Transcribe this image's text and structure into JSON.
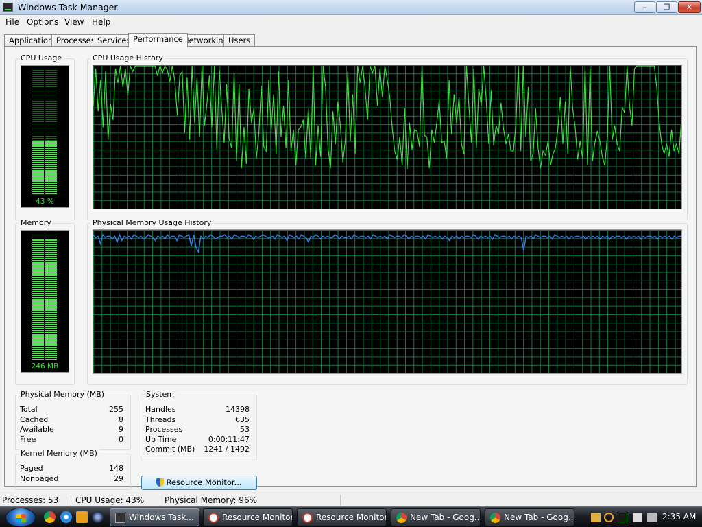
{
  "window": {
    "title": "Windows Task Manager",
    "buttons": {
      "minimize": "‒",
      "maximize": "❐",
      "close": "✕"
    }
  },
  "menu": [
    "File",
    "Options",
    "View",
    "Help"
  ],
  "tabs": [
    "Applications",
    "Processes",
    "Services",
    "Performance",
    "Networking",
    "Users"
  ],
  "active_tab": "Performance",
  "cpu": {
    "group_label": "CPU Usage",
    "value_label": "43 %",
    "percent": 43,
    "history_label": "CPU Usage History",
    "history": [
      72,
      98,
      68,
      90,
      57,
      96,
      48,
      73,
      62,
      98,
      88,
      100,
      85,
      98,
      79,
      100,
      96,
      100,
      100,
      100,
      100,
      100,
      100,
      100,
      100,
      100,
      93,
      100,
      95,
      100,
      97,
      89,
      100,
      90,
      65,
      93,
      96,
      53,
      92,
      48,
      100,
      60,
      92,
      50,
      100,
      58,
      73,
      93,
      57,
      100,
      41,
      97,
      70,
      46,
      87,
      49,
      42,
      95,
      33,
      87,
      28,
      57,
      31,
      84,
      60,
      70,
      35,
      52,
      86,
      43,
      40,
      90,
      55,
      80,
      38,
      96,
      50,
      72,
      42,
      90,
      40,
      55,
      30,
      55,
      57,
      62,
      35,
      70,
      35,
      100,
      30,
      58,
      36,
      100,
      85,
      42,
      28,
      68,
      45,
      75,
      58,
      32,
      48,
      96,
      47,
      80,
      38,
      100,
      88,
      100,
      84,
      62,
      100,
      95,
      100,
      72,
      98,
      78,
      100,
      90,
      78,
      56,
      40,
      34,
      50,
      30,
      70,
      27,
      60,
      41,
      55,
      54,
      43,
      100,
      51,
      50,
      28,
      55,
      46,
      60,
      76,
      46,
      47,
      35,
      90,
      52,
      80,
      60,
      78,
      45,
      38,
      100,
      72,
      46,
      98,
      42,
      84,
      72,
      100,
      77,
      45,
      83,
      44,
      58,
      52,
      74,
      56,
      45,
      52,
      40,
      40,
      58,
      100,
      40,
      100,
      50,
      85,
      33,
      38,
      70,
      42,
      28,
      40,
      37,
      47,
      30,
      38,
      42,
      55,
      78,
      45,
      75,
      38,
      100,
      70,
      57,
      34,
      47,
      35,
      100,
      30,
      98,
      33,
      46,
      54,
      47,
      36,
      30,
      50,
      100,
      48,
      58,
      45,
      40,
      71,
      67,
      100,
      72,
      58,
      98,
      100,
      100,
      100,
      100,
      100,
      100,
      100,
      100,
      85,
      60,
      45,
      38,
      45,
      36,
      55,
      40,
      45,
      38,
      62
    ],
    "color": "#3fdc3f"
  },
  "memory": {
    "group_label": "Memory",
    "value_label": "246 MB",
    "percent": 96,
    "history_label": "Physical Memory Usage History",
    "history": [
      97,
      95,
      96,
      91,
      97,
      95,
      96,
      96,
      94,
      96,
      92,
      97,
      93,
      96,
      95,
      96,
      94,
      97,
      96,
      95,
      96,
      94,
      95,
      97,
      96,
      95,
      93,
      96,
      95,
      96,
      94,
      97,
      95,
      96,
      96,
      93,
      97,
      96,
      95,
      96,
      97,
      89,
      97,
      88,
      85,
      96,
      94,
      96,
      95,
      97,
      96,
      94,
      95,
      96,
      96,
      97,
      95,
      96,
      94,
      97,
      96,
      95,
      96,
      96,
      95,
      97,
      96,
      94,
      96,
      95,
      96,
      97,
      96,
      95,
      95,
      96,
      94,
      97,
      96,
      95,
      96,
      93,
      97,
      96,
      95,
      96,
      94,
      97,
      96,
      95,
      92,
      96,
      95,
      97,
      96,
      94,
      96,
      95,
      96,
      95,
      95,
      97,
      96,
      94,
      96,
      95,
      95,
      96,
      94,
      97,
      96,
      95,
      96,
      96,
      95,
      96,
      94,
      97,
      96,
      95,
      96,
      95,
      96,
      94,
      97,
      96,
      95,
      96,
      96,
      95,
      97,
      96,
      94,
      96,
      95,
      96,
      96,
      95,
      96,
      94,
      97,
      96,
      95,
      96,
      95,
      96,
      94,
      96,
      95,
      93,
      96,
      95,
      96,
      94,
      96,
      95,
      96,
      96,
      95,
      97,
      96,
      94,
      96,
      95,
      96,
      95,
      96,
      94,
      97,
      96,
      95,
      96,
      96,
      95,
      96,
      94,
      96,
      95,
      96,
      95,
      86,
      96,
      95,
      96,
      94,
      97,
      96,
      95,
      96,
      96,
      95,
      96,
      94,
      97,
      96,
      95,
      96,
      95,
      96,
      94,
      96,
      95,
      96,
      96,
      95,
      96,
      94,
      96,
      95,
      96,
      95,
      96,
      94,
      96,
      95,
      96,
      94,
      96,
      95,
      96,
      96,
      95,
      96,
      94,
      96,
      95,
      96,
      95,
      96,
      94,
      96,
      95,
      96,
      96,
      95,
      96,
      94,
      96,
      95,
      96,
      95,
      96,
      94,
      96,
      95,
      96,
      96
    ],
    "color": "#2f7ee0"
  },
  "physical_memory": {
    "label": "Physical Memory (MB)",
    "rows": [
      [
        "Total",
        "255"
      ],
      [
        "Cached",
        "8"
      ],
      [
        "Available",
        "9"
      ],
      [
        "Free",
        "0"
      ]
    ]
  },
  "kernel_memory": {
    "label": "Kernel Memory (MB)",
    "rows": [
      [
        "Paged",
        "148"
      ],
      [
        "Nonpaged",
        "29"
      ]
    ]
  },
  "system": {
    "label": "System",
    "rows": [
      [
        "Handles",
        "14398"
      ],
      [
        "Threads",
        "635"
      ],
      [
        "Processes",
        "53"
      ],
      [
        "Up Time",
        "0:00:11:47"
      ],
      [
        "Commit (MB)",
        "1241 / 1492"
      ]
    ]
  },
  "resource_monitor_button": "Resource Monitor...",
  "status": {
    "processes": "Processes: 53",
    "cpu": "CPU Usage: 43%",
    "memory": "Physical Memory: 96%"
  },
  "taskbar": {
    "tasks": [
      {
        "label": "Windows Task...",
        "icon": "task-manager-icon",
        "active": true
      },
      {
        "label": "Resource Monitor",
        "icon": "resource-monitor-icon"
      },
      {
        "label": "Resource Monitor",
        "icon": "resource-monitor-icon"
      },
      {
        "label": "New Tab - Goog...",
        "icon": "chrome-icon"
      },
      {
        "label": "New Tab - Goog...",
        "icon": "chrome-icon"
      }
    ],
    "clock": "2:35 AM"
  }
}
